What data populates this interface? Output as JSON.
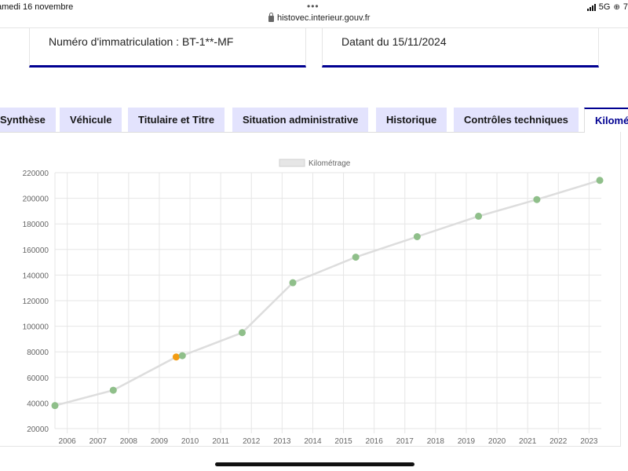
{
  "status_bar": {
    "date": "amedi 16 novembre",
    "url": "histovec.interieur.gouv.fr",
    "network": "5G",
    "battery": "7"
  },
  "cards": [
    {
      "text": "Numéro d'immatriculation : BT-1**-MF"
    },
    {
      "text": "Datant du 15/11/2024"
    }
  ],
  "tabs": [
    {
      "label": "Synthèse",
      "active": false
    },
    {
      "label": "Véhicule",
      "active": false
    },
    {
      "label": "Titulaire et Titre",
      "active": false
    },
    {
      "label": "Situation administrative",
      "active": false
    },
    {
      "label": "Historique",
      "active": false
    },
    {
      "label": "Contrôles techniques",
      "active": false
    },
    {
      "label": "Kilomé",
      "active": true
    }
  ],
  "chart_data": {
    "type": "line",
    "legend": {
      "label": "Kilométrage",
      "position": "top"
    },
    "xlabel": "",
    "ylabel": "",
    "x_ticks": [
      "2006",
      "2007",
      "2008",
      "2009",
      "2010",
      "2011",
      "2012",
      "2013",
      "2014",
      "2015",
      "2016",
      "2017",
      "2018",
      "2019",
      "2020",
      "2021",
      "2022",
      "2023"
    ],
    "y_ticks": [
      "20000",
      "40000",
      "60000",
      "80000",
      "100000",
      "120000",
      "140000",
      "160000",
      "180000",
      "200000",
      "220000"
    ],
    "xlim": [
      2005.6,
      2023.4
    ],
    "ylim": [
      20000,
      220000
    ],
    "grid": true,
    "series": [
      {
        "name": "Kilométrage",
        "line_color": "#dddddd",
        "points": [
          {
            "x": 2005.6,
            "y": 38000,
            "color": "#8fbf8a"
          },
          {
            "x": 2007.5,
            "y": 50000,
            "color": "#8fbf8a"
          },
          {
            "x": 2009.55,
            "y": 76000,
            "color": "#f39c12"
          },
          {
            "x": 2009.75,
            "y": 77000,
            "color": "#8fbf8a"
          },
          {
            "x": 2011.7,
            "y": 95000,
            "color": "#8fbf8a"
          },
          {
            "x": 2013.35,
            "y": 134000,
            "color": "#8fbf8a"
          },
          {
            "x": 2015.4,
            "y": 154000,
            "color": "#8fbf8a"
          },
          {
            "x": 2017.4,
            "y": 170000,
            "color": "#8fbf8a"
          },
          {
            "x": 2019.4,
            "y": 186000,
            "color": "#8fbf8a"
          },
          {
            "x": 2021.3,
            "y": 199000,
            "color": "#8fbf8a"
          },
          {
            "x": 2023.35,
            "y": 214000,
            "color": "#8fbf8a"
          }
        ]
      }
    ]
  }
}
